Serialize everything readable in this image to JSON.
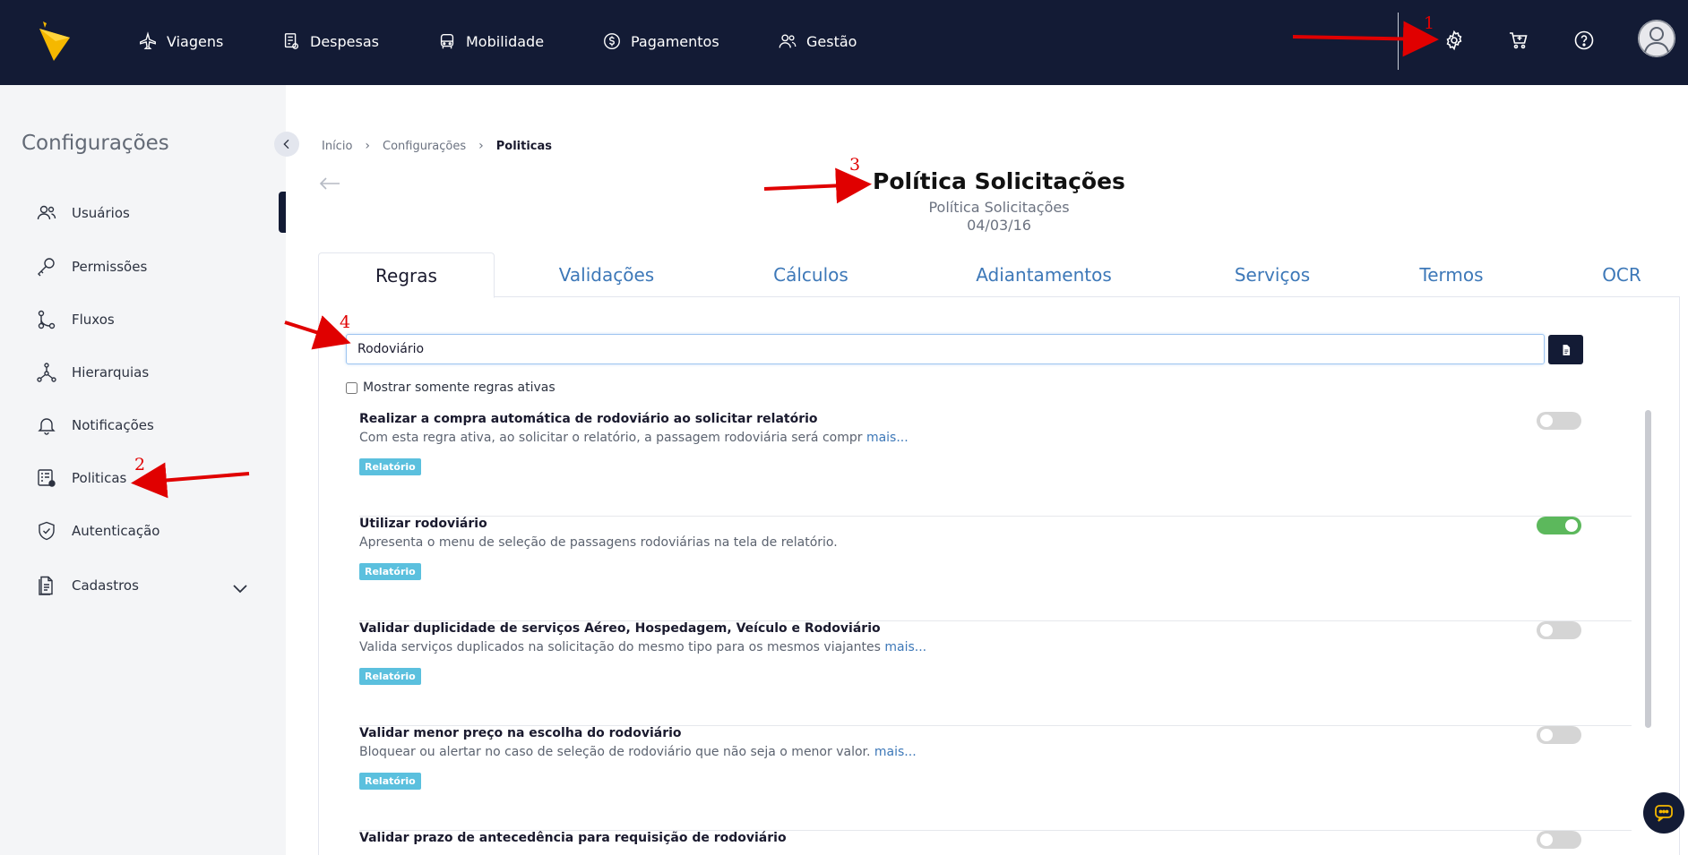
{
  "topbar": {
    "nav": [
      {
        "label": "Viagens",
        "icon": "plane-icon"
      },
      {
        "label": "Despesas",
        "icon": "receipt-icon"
      },
      {
        "label": "Mobilidade",
        "icon": "car-icon"
      },
      {
        "label": "Pagamentos",
        "icon": "dollar-icon"
      },
      {
        "label": "Gestão",
        "icon": "users-icon"
      }
    ],
    "icons": [
      "gear-icon",
      "cart-icon",
      "help-icon",
      "avatar-icon"
    ]
  },
  "sidebar": {
    "title": "Configurações",
    "items": [
      {
        "label": "Usuários",
        "icon": "users-icon"
      },
      {
        "label": "Permissões",
        "icon": "key-icon"
      },
      {
        "label": "Fluxos",
        "icon": "flow-icon"
      },
      {
        "label": "Hierarquias",
        "icon": "hierarchy-icon"
      },
      {
        "label": "Notificações",
        "icon": "bell-icon"
      },
      {
        "label": "Politicas",
        "icon": "policy-icon"
      },
      {
        "label": "Autenticação",
        "icon": "shield-icon"
      },
      {
        "label": "Cadastros",
        "icon": "document-icon"
      }
    ]
  },
  "breadcrumb": {
    "home": "Início",
    "section": "Configurações",
    "current": "Politicas"
  },
  "header": {
    "title": "Política Solicitações",
    "subtitle": "Política Solicitações",
    "date": "04/03/16"
  },
  "tabs": [
    {
      "label": "Regras",
      "active": true
    },
    {
      "label": "Validações"
    },
    {
      "label": "Cálculos"
    },
    {
      "label": "Adiantamentos"
    },
    {
      "label": "Serviços"
    },
    {
      "label": "Termos"
    },
    {
      "label": "OCR"
    }
  ],
  "search": {
    "value": "Rodoviário"
  },
  "filter": {
    "label": "Mostrar somente regras ativas",
    "checked": false
  },
  "rules": [
    {
      "title": "Realizar a compra automática de rodoviário ao solicitar relatório",
      "desc": "Com esta regra ativa, ao solicitar o relatório, a passagem rodoviária será compr ",
      "more": "mais...",
      "tag": "Relatório",
      "enabled": false
    },
    {
      "title": "Utilizar rodoviário",
      "desc": "Apresenta o menu de seleção de passagens rodoviárias na tela de relatório.",
      "more": "",
      "tag": "Relatório",
      "enabled": true
    },
    {
      "title": "Validar duplicidade de serviços Aéreo, Hospedagem, Veículo e Rodoviário",
      "desc": "Valida serviços duplicados na solicitação do mesmo tipo para os mesmos viajantes ",
      "more": "mais...",
      "tag": "Relatório",
      "enabled": false
    },
    {
      "title": "Validar menor preço na escolha do rodoviário",
      "desc": "Bloquear ou alertar no caso de seleção de rodoviário que não seja o menor valor. ",
      "more": "mais...",
      "tag": "Relatório",
      "enabled": false
    },
    {
      "title": "Validar prazo de antecedência para requisição de rodoviário",
      "desc": "",
      "more": "",
      "tag": "",
      "enabled": false
    }
  ],
  "annotations": [
    "1",
    "2",
    "3",
    "4"
  ],
  "colors": {
    "topbar": "#131b35",
    "accent": "#3d78b8",
    "tag": "#5bc0de",
    "toggle_on": "#5cb85c",
    "annotation": "#e00000"
  }
}
